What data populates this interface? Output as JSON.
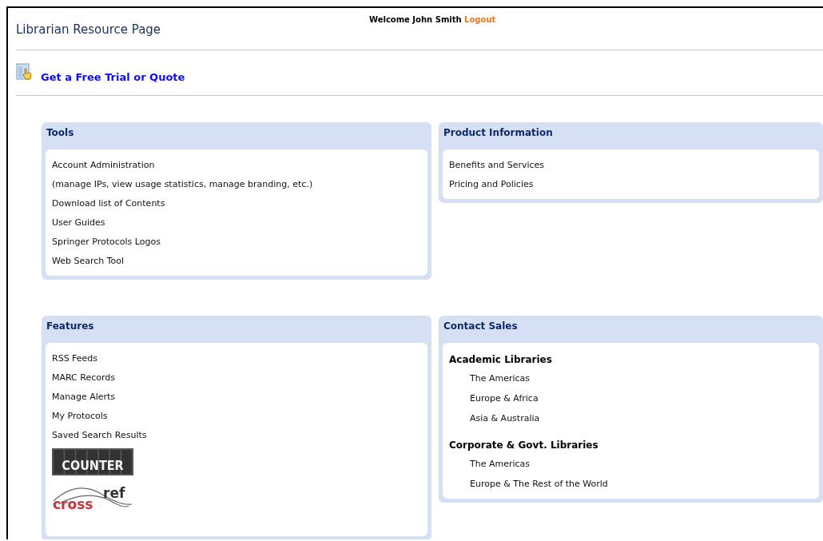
{
  "header": {
    "title": "Librarian Resource Page",
    "welcome": "Welcome John Smith",
    "logout": "Logout"
  },
  "trial_link": "Get a Free Trial or Quote",
  "panels": [
    {
      "title": "Tools",
      "items": [
        {
          "kind": "link",
          "text": "Account Administration"
        },
        {
          "kind": "link",
          "text": "(manage IPs, view usage statistics, manage branding, etc.)"
        },
        {
          "kind": "link",
          "text": "Download list of Contents"
        },
        {
          "kind": "link",
          "text": "User Guides"
        },
        {
          "kind": "link",
          "text": "Springer Protocols Logos"
        },
        {
          "kind": "link",
          "text": "Web Search Tool"
        }
      ]
    },
    {
      "title": "Product Information",
      "items": [
        {
          "kind": "link",
          "text": "Benefits and Services"
        },
        {
          "kind": "link",
          "text": "Pricing and Policies"
        }
      ]
    },
    {
      "title": "Features",
      "items": [
        {
          "kind": "link",
          "text": "RSS Feeds"
        },
        {
          "kind": "link",
          "text": "MARC Records"
        },
        {
          "kind": "link",
          "text": "Manage Alerts"
        },
        {
          "kind": "link",
          "text": "My Protocols"
        },
        {
          "kind": "link",
          "text": "Saved Search Results"
        },
        {
          "kind": "counter_logo",
          "text": "COUNTER"
        },
        {
          "kind": "crossref_logo",
          "parts": [
            "cross",
            "ref"
          ]
        }
      ]
    },
    {
      "title": "Contact Sales",
      "items": [
        {
          "kind": "group",
          "text": "Academic Libraries",
          "children": [
            {
              "text": "The Americas"
            },
            {
              "text": "Europe & Africa"
            },
            {
              "text": "Asia & Australia"
            }
          ]
        },
        {
          "kind": "group",
          "text": "Corporate & Govt. Libraries",
          "children": [
            {
              "text": "The Americas"
            },
            {
              "text": "Europe & The Rest of the World"
            }
          ]
        }
      ]
    }
  ]
}
